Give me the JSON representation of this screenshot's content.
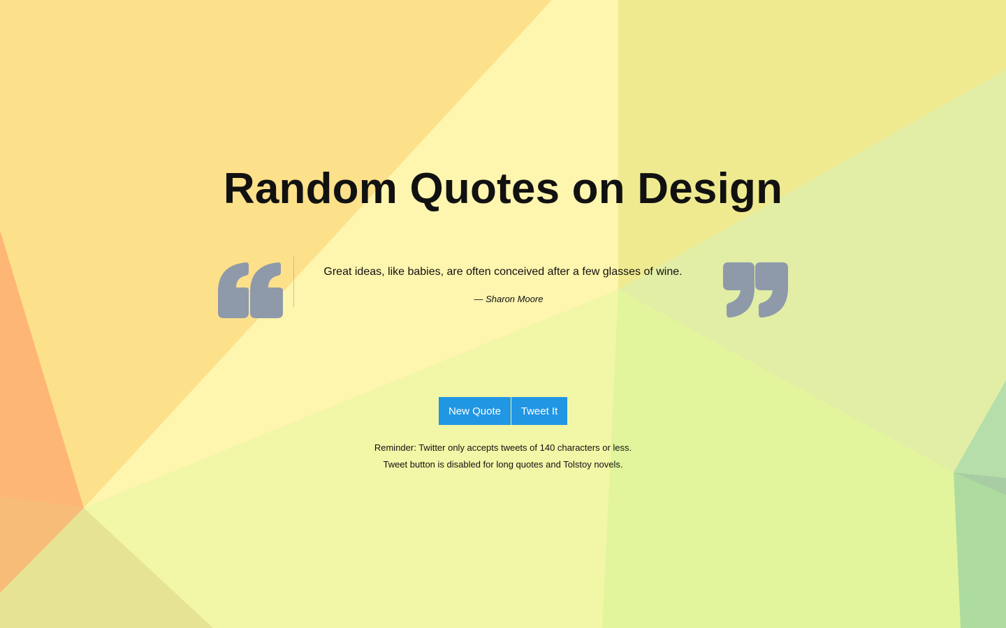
{
  "page": {
    "title": "Random Quotes on Design"
  },
  "quote": {
    "text": "Great ideas, like babies, are often conceived after a few glasses of wine.",
    "author": "— Sharon Moore",
    "open_icon": "quote-open-icon",
    "close_icon": "quote-close-icon",
    "icon_color": "#8e9aaa"
  },
  "actions": {
    "new_quote_label": "New Quote",
    "tweet_label": "Tweet It",
    "button_color": "#2196e3"
  },
  "reminder": {
    "line1": "Reminder: Twitter only accepts tweets of 140 characters or less.",
    "line2": "Tweet button is disabled for long quotes and Tolstoy novels."
  }
}
